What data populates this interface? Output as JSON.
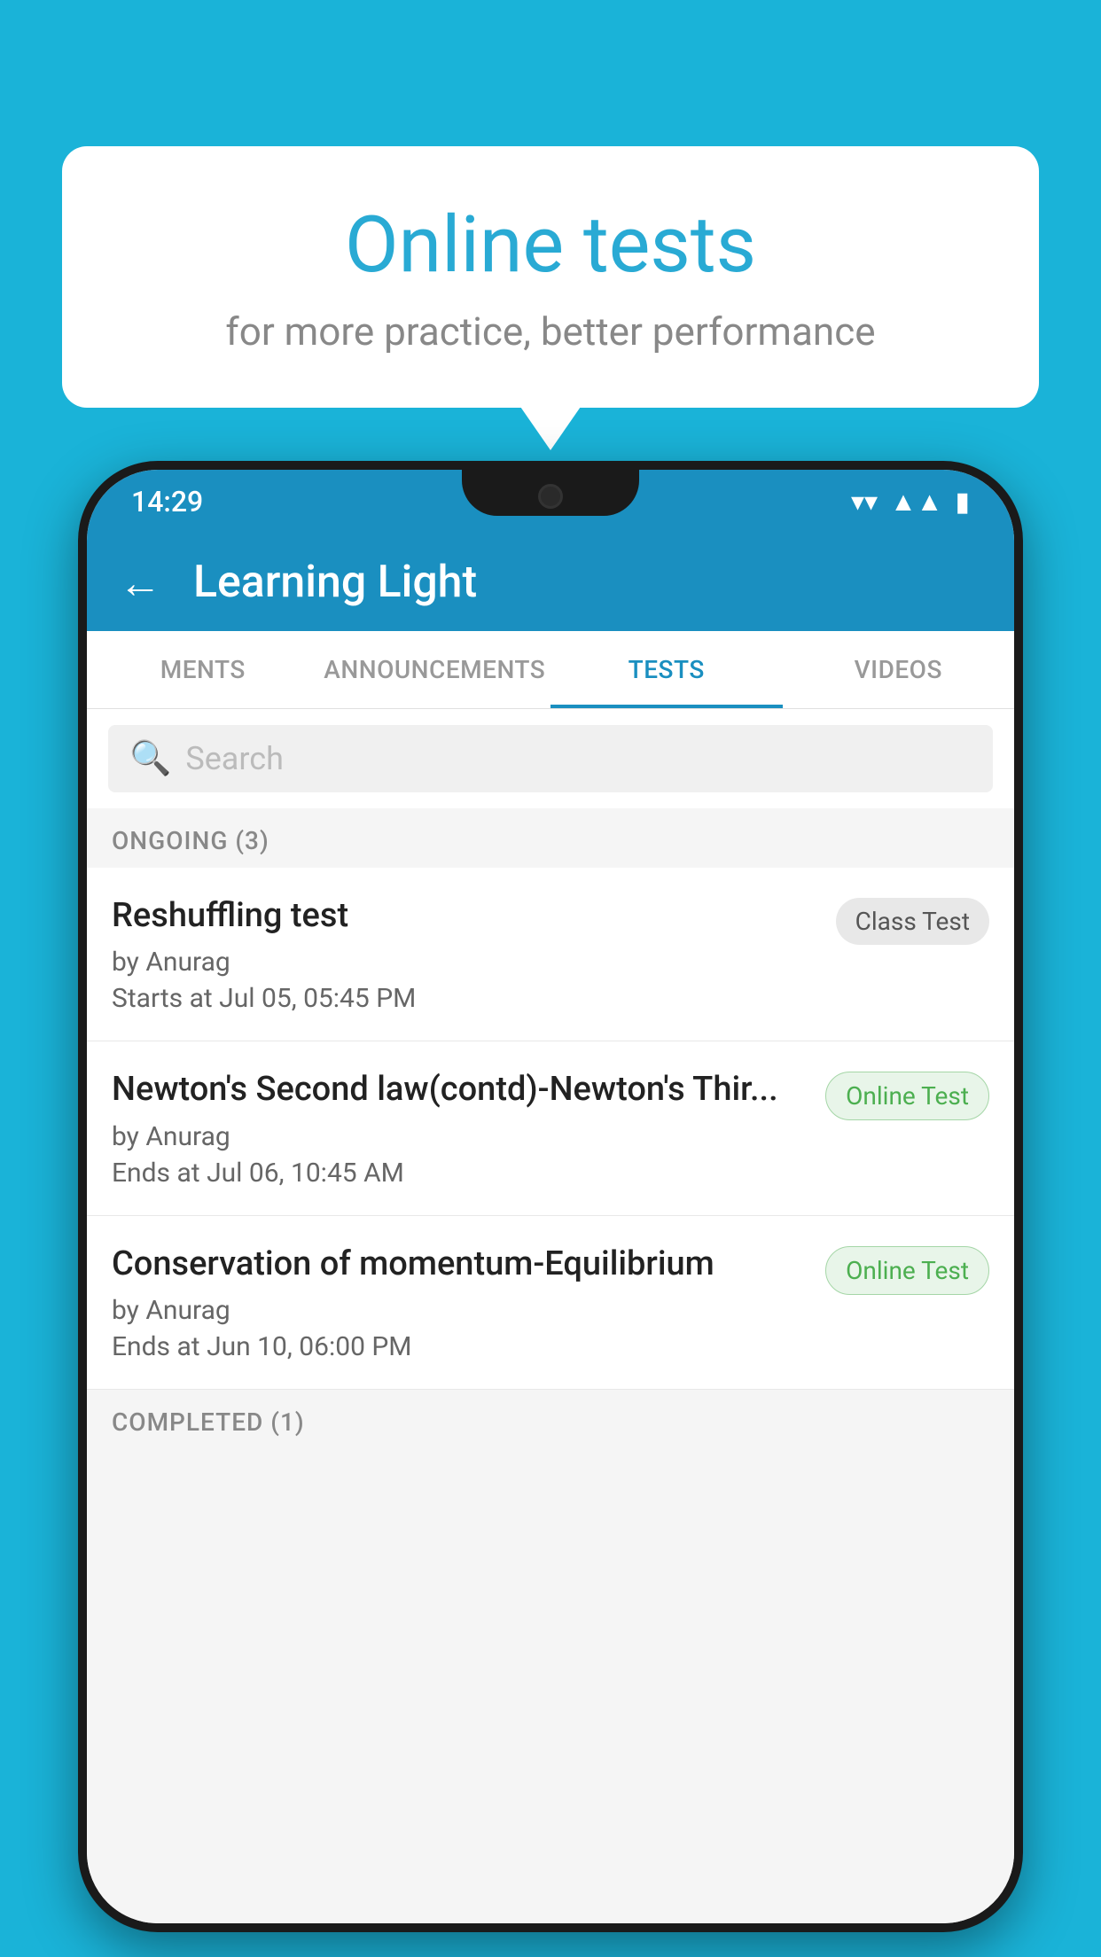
{
  "background": {
    "color": "#1ab3d8"
  },
  "speech_bubble": {
    "title": "Online tests",
    "subtitle": "for more practice, better performance"
  },
  "phone": {
    "status_bar": {
      "time": "14:29",
      "wifi": "▼",
      "signal": "▲",
      "battery": "▮"
    },
    "app_bar": {
      "back_label": "←",
      "title": "Learning Light"
    },
    "tabs": [
      {
        "label": "MENTS",
        "active": false
      },
      {
        "label": "ANNOUNCEMENTS",
        "active": false
      },
      {
        "label": "TESTS",
        "active": true
      },
      {
        "label": "VIDEOS",
        "active": false
      }
    ],
    "search": {
      "placeholder": "Search"
    },
    "section_ongoing": {
      "label": "ONGOING (3)"
    },
    "test_items": [
      {
        "name": "Reshuffling test",
        "author": "by Anurag",
        "time_label": "Starts at",
        "time_value": "Jul 05, 05:45 PM",
        "badge": "Class Test",
        "badge_type": "class"
      },
      {
        "name": "Newton's Second law(contd)-Newton's Thir...",
        "author": "by Anurag",
        "time_label": "Ends at",
        "time_value": "Jul 06, 10:45 AM",
        "badge": "Online Test",
        "badge_type": "online"
      },
      {
        "name": "Conservation of momentum-Equilibrium",
        "author": "by Anurag",
        "time_label": "Ends at",
        "time_value": "Jun 10, 06:00 PM",
        "badge": "Online Test",
        "badge_type": "online"
      }
    ],
    "section_completed": {
      "label": "COMPLETED (1)"
    }
  }
}
